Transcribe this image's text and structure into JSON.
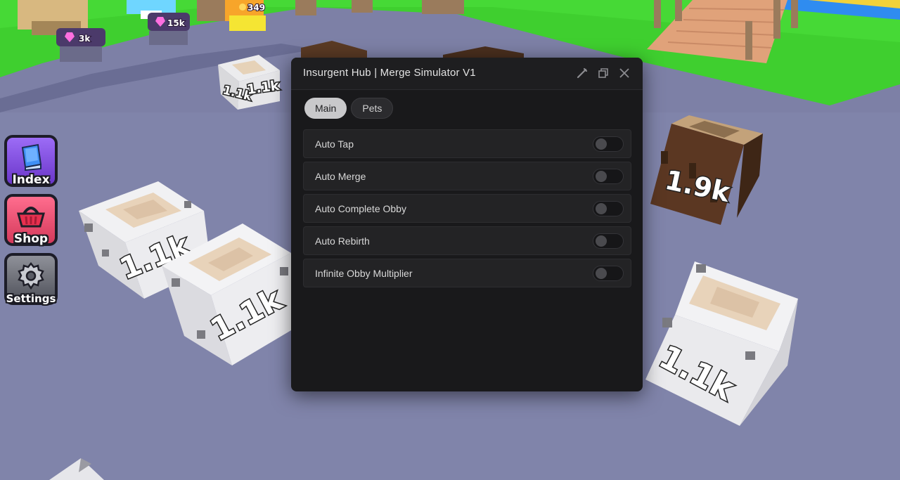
{
  "hub": {
    "title": "Insurgent Hub | Merge Simulator V1",
    "tabs": [
      {
        "label": "Main",
        "active": true
      },
      {
        "label": "Pets",
        "active": false
      }
    ],
    "options": [
      {
        "label": "Auto Tap",
        "enabled": false
      },
      {
        "label": "Auto Merge",
        "enabled": false
      },
      {
        "label": "Auto Complete Obby",
        "enabled": false
      },
      {
        "label": "Auto Rebirth",
        "enabled": false
      },
      {
        "label": "Infinite Obby Multiplier",
        "enabled": false
      }
    ],
    "title_buttons": [
      "edit-icon",
      "restore-icon",
      "close-icon"
    ]
  },
  "side_menu": {
    "index_label": "Index",
    "shop_label": "Shop",
    "settings_label": "Settings"
  },
  "world": {
    "blocks": [
      {
        "label": "1.1k",
        "material": "stone"
      },
      {
        "label": "1.1k",
        "material": "stone"
      },
      {
        "label": "1.1k",
        "material": "stone"
      },
      {
        "label": "1.1k",
        "material": "stone"
      },
      {
        "label": "1.1k",
        "material": "stone"
      },
      {
        "label": "1.9k",
        "material": "wood"
      }
    ],
    "badges": [
      {
        "label": "3k",
        "icon": "gem-icon"
      },
      {
        "label": "15k",
        "icon": "gem-icon"
      },
      {
        "label": "349",
        "icon": "coin-icon"
      }
    ]
  },
  "colors": {
    "ground": "#7d80a6",
    "grass": "#3fcf2f",
    "panel_bg": "#19191b",
    "row_bg": "#232325",
    "tab_active": "#c9c9cb"
  }
}
